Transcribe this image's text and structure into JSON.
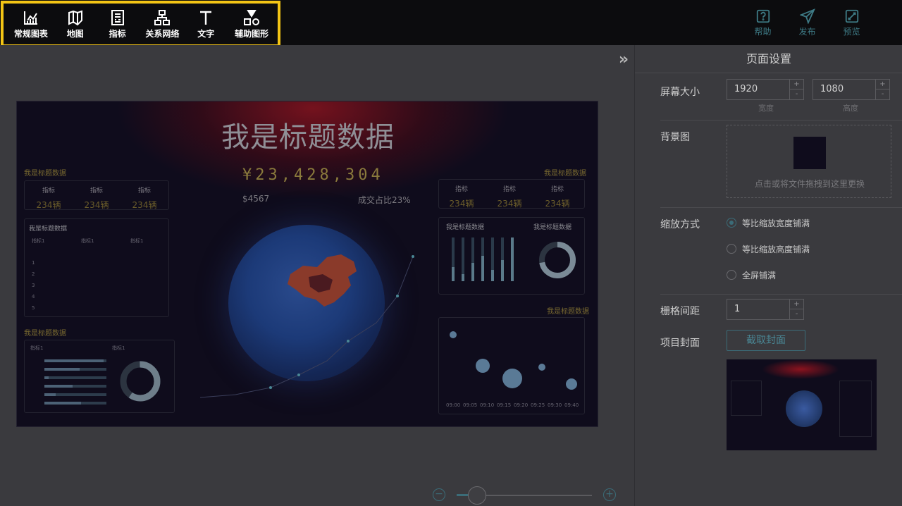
{
  "toolbar": {
    "items": [
      {
        "label": "常规图表",
        "icon": "chart-icon"
      },
      {
        "label": "地图",
        "icon": "map-icon"
      },
      {
        "label": "指标",
        "icon": "indicator-icon"
      },
      {
        "label": "关系网络",
        "icon": "network-icon"
      },
      {
        "label": "文字",
        "icon": "text-icon"
      },
      {
        "label": "辅助图形",
        "icon": "shapes-icon"
      }
    ],
    "highlight_color": "#f3c515"
  },
  "header_actions": [
    {
      "label": "帮助",
      "icon": "help-icon"
    },
    {
      "label": "发布",
      "icon": "send-icon"
    },
    {
      "label": "预览",
      "icon": "preview-icon"
    }
  ],
  "canvas": {
    "title": "我是标题数据",
    "amount": "¥23,428,304",
    "sub_left": "$4567",
    "sub_right": "成交占比23%",
    "section_title": "我是标题数据",
    "indicator_label": "指标",
    "indicator_value": "234辆",
    "list_header": "指标1",
    "list_rows": [
      "1",
      "2",
      "3",
      "4",
      "5"
    ],
    "axis_times": [
      "09:00",
      "09:05",
      "09:10",
      "09:15",
      "09:20",
      "09:25",
      "09:30",
      "09:40"
    ]
  },
  "zoom": {
    "level": 0.1
  },
  "settings": {
    "title": "页面设置",
    "screen_size_label": "屏幕大小",
    "width_value": "1920",
    "height_value": "1080",
    "width_caption": "宽度",
    "height_caption": "高度",
    "bg_label": "背景图",
    "upload_text": "点击或将文件拖拽到这里更换",
    "scale_label": "缩放方式",
    "scale_options": [
      "等比缩放宽度铺满",
      "等比缩放高度铺满",
      "全屏铺满"
    ],
    "scale_selected": 0,
    "grid_label": "栅格间距",
    "grid_value": "1",
    "cover_label": "项目封面",
    "capture_button": "截取封面",
    "accent_color": "#3b6c78"
  }
}
